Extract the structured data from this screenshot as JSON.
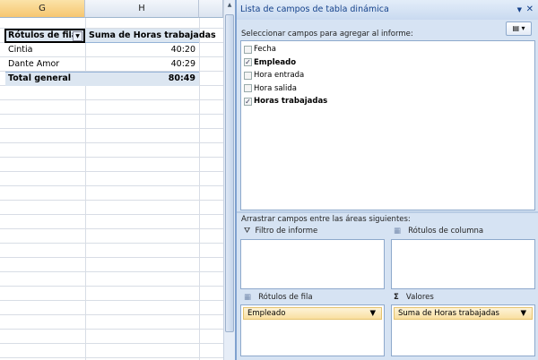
{
  "sheet": {
    "columns": [
      "G",
      "H"
    ],
    "pivot": {
      "header": [
        "Rótulos de fila",
        "Suma de Horas trabajadas"
      ],
      "rows": [
        {
          "label": "Cintia",
          "value": "40:20"
        },
        {
          "label": "Dante Amor",
          "value": "40:29"
        }
      ],
      "total": {
        "label": "Total general",
        "value": "80:49"
      }
    }
  },
  "panel": {
    "title": "Lista de campos de tabla dinámica",
    "select_label": "Seleccionar campos para agregar al informe:",
    "fields": [
      {
        "name": "Fecha",
        "checked": false
      },
      {
        "name": "Empleado",
        "checked": true
      },
      {
        "name": "Hora entrada",
        "checked": false
      },
      {
        "name": "Hora salida",
        "checked": false
      },
      {
        "name": "Horas trabajadas",
        "checked": true
      }
    ],
    "drag_label": "Arrastrar campos entre las áreas siguientes:",
    "areas": {
      "filter": "Filtro de informe",
      "columns": "Rótulos de columna",
      "rows": "Rótulos de fila",
      "values": "Valores"
    },
    "row_item": "Empleado",
    "value_item": "Suma de Horas trabajadas",
    "check": "✓"
  }
}
